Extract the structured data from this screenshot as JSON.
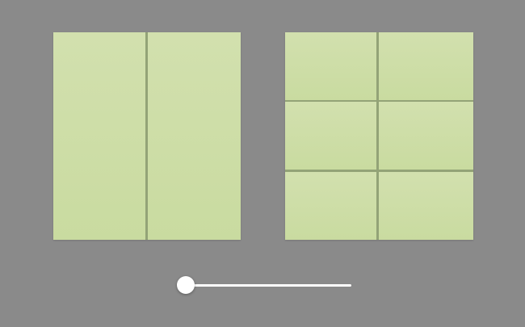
{
  "layouts": [
    {
      "name": "two-column",
      "tiles": 2,
      "tile_color": "#cfdea8"
    },
    {
      "name": "three-row-two-column-grid",
      "tiles": 6,
      "tile_color": "#cfdea8"
    }
  ],
  "slider": {
    "value_fraction": 0,
    "track_color": "#ffffff",
    "thumb_color": "#ffffff"
  },
  "colors": {
    "background": "#8a8a8a",
    "tile": "#cfdea8",
    "divider": "#93a377"
  }
}
